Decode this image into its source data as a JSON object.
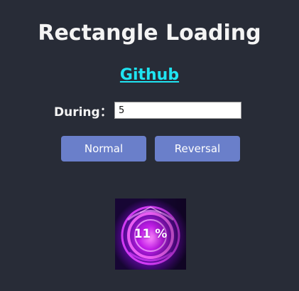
{
  "page": {
    "title": "Rectangle Loading",
    "link_label": "Github"
  },
  "controls": {
    "during_label": "During：",
    "during_value": "5",
    "normal_label": "Normal",
    "reversal_label": "Reversal"
  },
  "loader": {
    "progress_percent": 11,
    "progress_text": "11 %",
    "icon": "magic-circle-icon"
  },
  "colors": {
    "background": "#282c37",
    "link": "#1fe4f2",
    "button": "#6a7fca",
    "loader_glow": "#d21cff"
  }
}
